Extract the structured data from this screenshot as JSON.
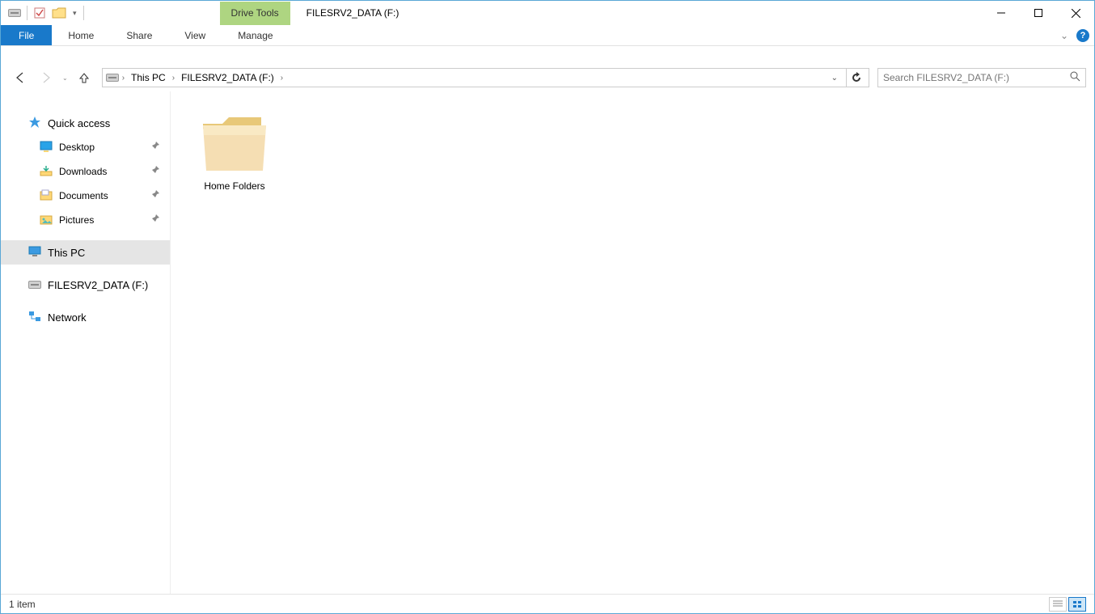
{
  "title": "FILESRV2_DATA (F:)",
  "drive_tools_label": "Drive Tools",
  "tabs": {
    "file": "File",
    "home": "Home",
    "share": "Share",
    "view": "View",
    "manage": "Manage"
  },
  "breadcrumbs": {
    "root": "This PC",
    "current": "FILESRV2_DATA (F:)"
  },
  "search_placeholder": "Search FILESRV2_DATA (F:)",
  "navpane": {
    "quick_access": "Quick access",
    "desktop": "Desktop",
    "downloads": "Downloads",
    "documents": "Documents",
    "pictures": "Pictures",
    "this_pc": "This PC",
    "drive": "FILESRV2_DATA (F:)",
    "network": "Network"
  },
  "content": {
    "items": [
      {
        "label": "Home Folders"
      }
    ]
  },
  "status": {
    "count_text": "1 item"
  }
}
